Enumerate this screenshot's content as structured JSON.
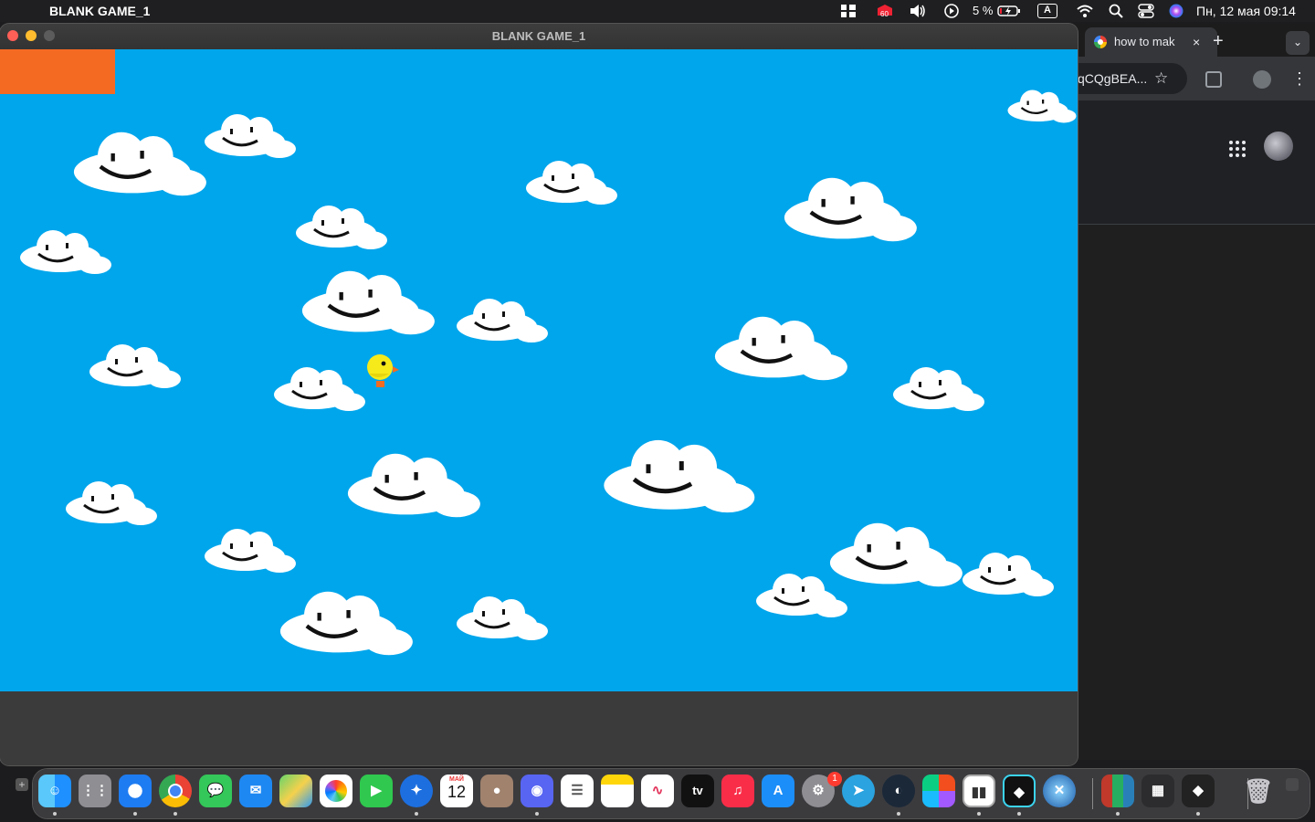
{
  "menubar": {
    "apple_glyph": "",
    "app_name": "BLANK GAME_1",
    "notification_count": "60",
    "battery_text": "5 %",
    "input_source": "A",
    "clock": "Пн, 12 мая  09:14"
  },
  "game": {
    "window_title": "BLANK GAME_1",
    "background_color": "#00a6ec",
    "block_color": "#f56a23",
    "player_icon": "yellow-chick-sprite"
  },
  "browser": {
    "tab_title": "how to mak",
    "tab_close": "×",
    "new_tab": "+",
    "tab_menu": "⌄",
    "omnibox_text": "qCQgBEA...",
    "star": "☆",
    "kebab": "⋮"
  },
  "dock": {
    "calendar_month": "МАЙ",
    "calendar_day": "12",
    "tv_label": "tv",
    "settings_badge": "1",
    "items": [
      "finder-icon",
      "launchpad-icon",
      "safari-icon",
      "chrome-icon",
      "messages-icon",
      "mail-icon",
      "maps-icon",
      "photos-icon",
      "facetime-icon",
      "vpn-icon",
      "calendar-icon",
      "contacts-icon",
      "discord-icon",
      "reminders-icon",
      "notes-icon",
      "freeform-icon",
      "apple-tv-icon",
      "music-icon",
      "app-store-icon",
      "system-settings-icon",
      "telegram-icon",
      "steam-icon",
      "figma-icon",
      "twitch-icon",
      "godot-icon",
      "hyperlink-icon",
      "winrar-icon",
      "calculator-icon",
      "godot-editor-icon",
      "trash-icon"
    ]
  }
}
